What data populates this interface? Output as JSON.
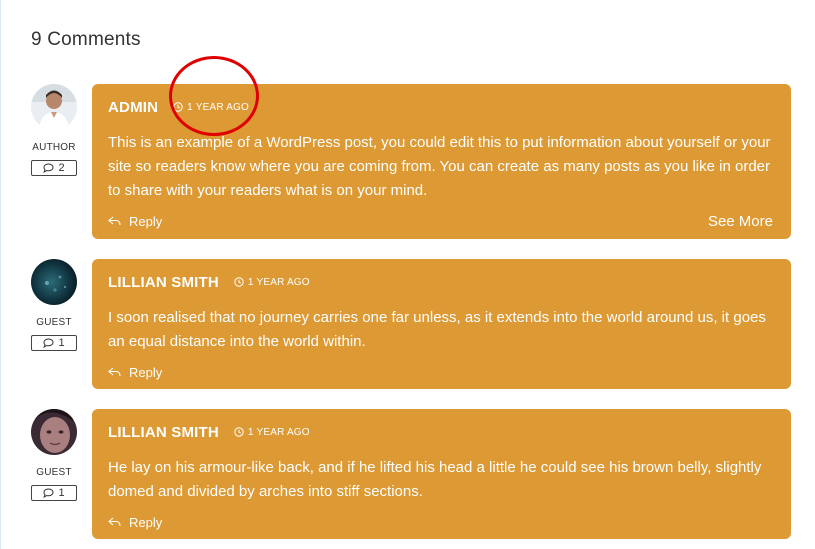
{
  "comments_heading": "9 Comments",
  "accent_color": "#dd9933",
  "annotation_color": "#e00000",
  "comments": [
    {
      "author": "ADMIN",
      "time": "1 YEAR AGO",
      "role": "AUTHOR",
      "count": "2",
      "text": "This is an example of a WordPress post, you could edit this to put information about yourself or your site so readers know where you are coming from. You can create as many posts as you like in order to share with your readers what is on your mind.",
      "reply_label": "Reply",
      "see_more_label": "See More"
    },
    {
      "author": "LILLIAN SMITH",
      "time": "1 YEAR AGO",
      "role": "GUEST",
      "count": "1",
      "text": "I soon realised that no journey carries one far unless, as it extends into the world around us, it goes an equal distance into the world within.",
      "reply_label": "Reply"
    },
    {
      "author": "LILLIAN SMITH",
      "time": "1 YEAR AGO",
      "role": "GUEST",
      "count": "1",
      "text": "He lay on his armour-like back, and if he lifted his head a little he could see his brown belly, slightly domed and divided by arches into stiff sections.",
      "reply_label": "Reply"
    }
  ]
}
